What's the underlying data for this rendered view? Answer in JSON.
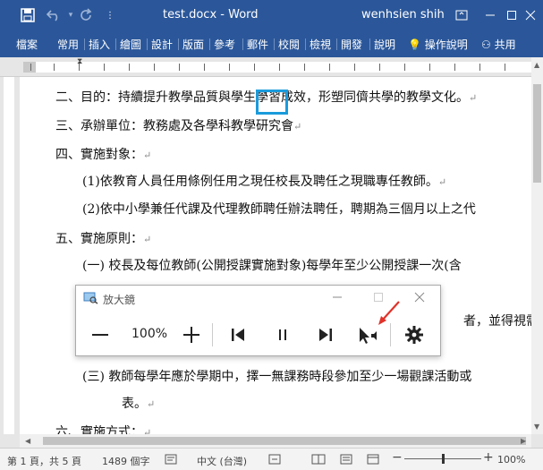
{
  "window": {
    "title": "test.docx - Word",
    "user": "wenhsien shih"
  },
  "ribbon": {
    "tabs": [
      "檔案",
      "常用",
      "插入",
      "繪圖",
      "設計",
      "版面",
      "參考",
      "郵件",
      "校閱",
      "檢視",
      "開發",
      "說明"
    ],
    "tell_me": "操作說明",
    "share": "共用"
  },
  "document": {
    "lines": [
      "二、目的：持續提升教學品質與學生學習成效，形塑同儕共學的教學文化。",
      "三、承辦單位：教務處及各學科教學研究會",
      "四、實施對象：",
      "(1)依教育人員任用條例任用之現任校長及聘任之現職專任教師。",
      "(2)依中小學兼任代課及代理教師聘任辦法聘任，聘期為三個月以上之代",
      "五、實施原則：",
      "(一) 校長及每位教師(公開授課實施對象)每學年至少公開授課一次(含",
      "者，並得視需要",
      "(三) 教師每學年應於學期中，擇一無課務時段參加至少一場觀課活動或",
      "表。",
      "六、實施方式："
    ]
  },
  "magnifier": {
    "title": "放大鏡",
    "zoom": "100%"
  },
  "status": {
    "page": "第 1 頁，共 5 頁",
    "words": "1489 個字",
    "language": "中文 (台灣)",
    "zoom": "100%"
  }
}
